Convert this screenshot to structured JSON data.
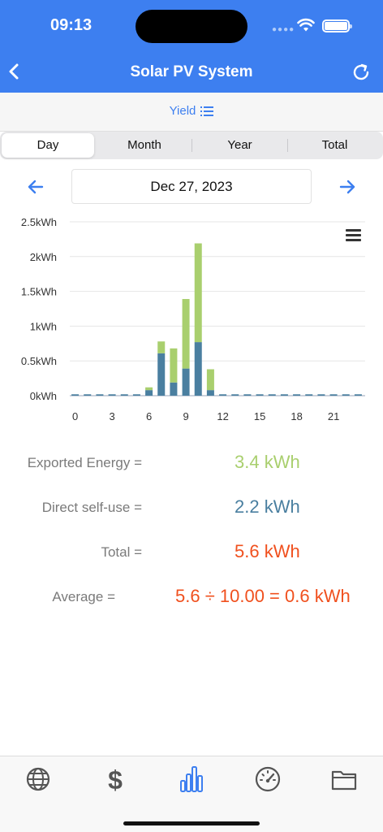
{
  "status": {
    "time": "09:13"
  },
  "nav": {
    "title": "Solar PV System",
    "back_icon": "chevron-left-icon",
    "refresh_icon": "refresh-icon"
  },
  "subheader": {
    "yield_label": "Yield",
    "icon": "list-icon"
  },
  "segments": [
    {
      "label": "Day",
      "active": true
    },
    {
      "label": "Month",
      "active": false
    },
    {
      "label": "Year",
      "active": false
    },
    {
      "label": "Total",
      "active": false
    }
  ],
  "date": {
    "value": "Dec 27, 2023",
    "prev_icon": "arrow-left-icon",
    "next_icon": "arrow-right-icon"
  },
  "chart_data": {
    "type": "bar",
    "stacked": true,
    "x": [
      0,
      1,
      2,
      3,
      4,
      5,
      6,
      7,
      8,
      9,
      10,
      11,
      12,
      13,
      14,
      15,
      16,
      17,
      18,
      19,
      20,
      21,
      22,
      23
    ],
    "x_tick_labels": [
      "0",
      "3",
      "6",
      "9",
      "12",
      "15",
      "18",
      "21"
    ],
    "y_tick_labels": [
      "0kWh",
      "0.5kWh",
      "1kWh",
      "1.5kWh",
      "2kWh",
      "2.5kWh"
    ],
    "ylim": [
      0,
      2.5
    ],
    "grid": true,
    "menu_icon": "hamburger-icon",
    "series": [
      {
        "color": "#4a7fa0",
        "values": [
          0.02,
          0.02,
          0.02,
          0.02,
          0.02,
          0.02,
          0.08,
          0.61,
          0.19,
          0.39,
          0.77,
          0.08,
          0.02,
          0.02,
          0.02,
          0.02,
          0.02,
          0.02,
          0.02,
          0.02,
          0.02,
          0.02,
          0.02,
          0.02
        ]
      },
      {
        "color": "#a9cf6e",
        "values": [
          0,
          0,
          0,
          0,
          0,
          0,
          0.04,
          0.17,
          0.49,
          1.0,
          1.42,
          0.3,
          0,
          0,
          0,
          0,
          0,
          0,
          0,
          0,
          0,
          0,
          0,
          0
        ]
      }
    ]
  },
  "stats": {
    "exported_label": "Exported Energy =",
    "exported_value": "3.4 kWh",
    "selfuse_label": "Direct self-use =",
    "selfuse_value": "2.2 kWh",
    "total_label": "Total =",
    "total_value": "5.6 kWh",
    "average_label": "Average =",
    "average_value": "5.6 ÷ 10.00 = 0.6 kWh"
  },
  "colors": {
    "accent": "#3d7ff0",
    "exported": "#a9cf6e",
    "selfuse": "#4a7fa0",
    "total": "#f0501e"
  },
  "tabs": [
    {
      "icon": "globe-icon"
    },
    {
      "icon": "dollar-icon"
    },
    {
      "icon": "bar-chart-icon",
      "active": true
    },
    {
      "icon": "speedometer-icon"
    },
    {
      "icon": "folder-icon"
    }
  ]
}
